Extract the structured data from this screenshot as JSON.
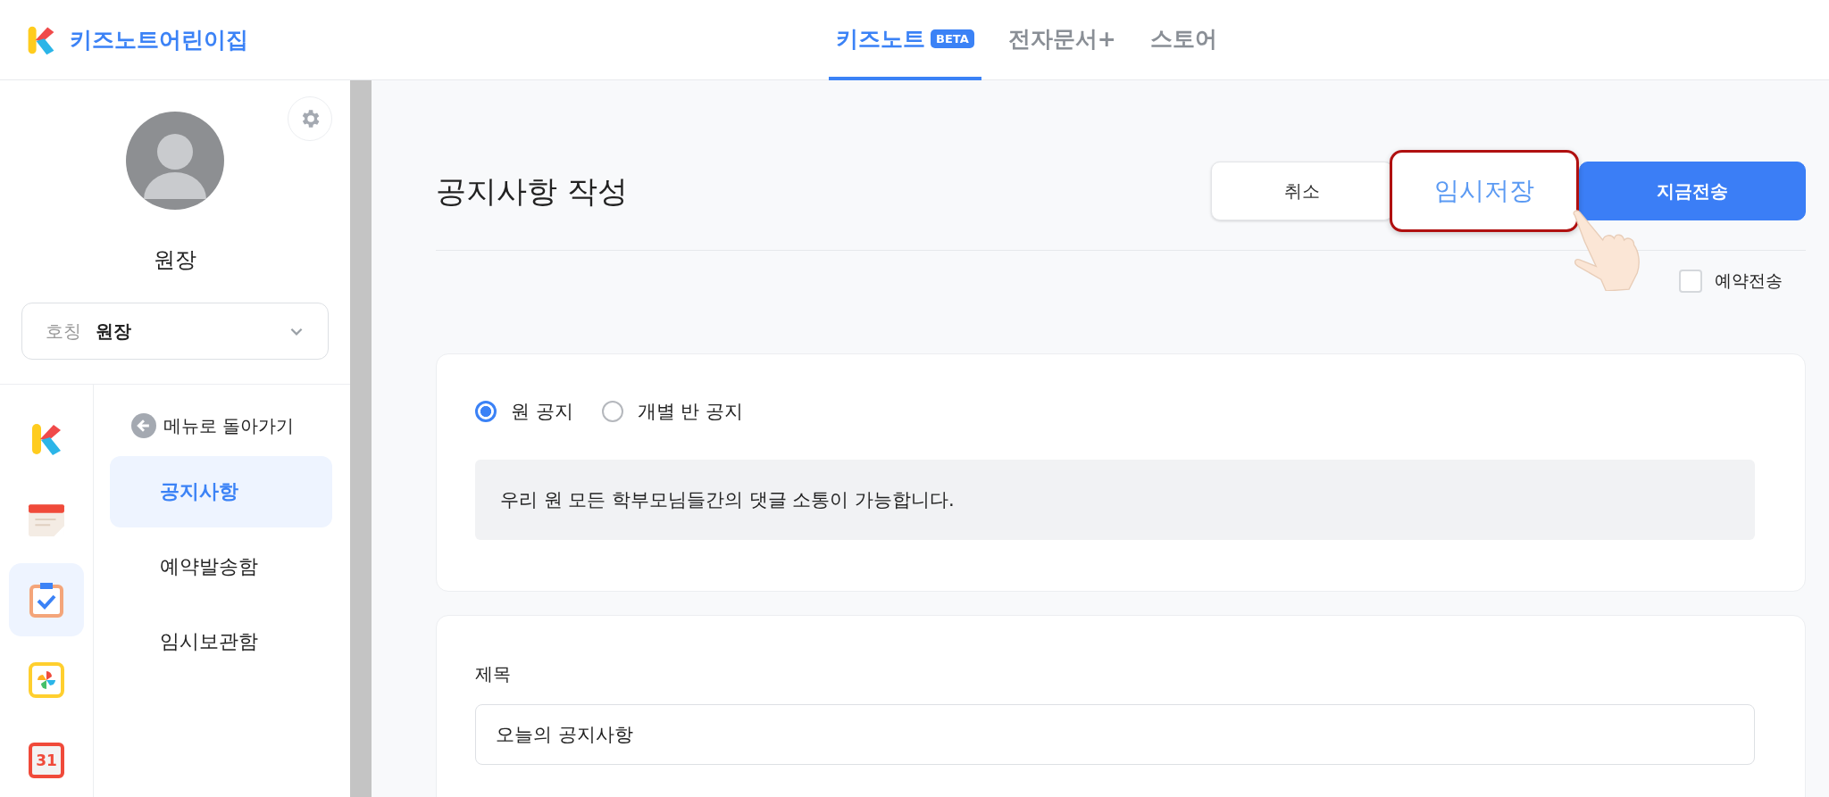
{
  "app": {
    "name": "키즈노트어린이집"
  },
  "nav_tabs": [
    {
      "label": "키즈노트",
      "badge": "BETA",
      "selected": true
    },
    {
      "label": "전자문서+",
      "selected": false
    },
    {
      "label": "스토어",
      "selected": false
    }
  ],
  "profile": {
    "name": "원장",
    "title_select": {
      "label": "호칭",
      "value": "원장"
    }
  },
  "rail_icons": [
    {
      "kind": "logo",
      "selected": false
    },
    {
      "kind": "memo",
      "selected": false
    },
    {
      "kind": "checklist",
      "selected": true
    },
    {
      "kind": "pinwheel",
      "selected": false
    },
    {
      "kind": "date",
      "text": "31",
      "selected": false
    }
  ],
  "menu": {
    "back": "메뉴로 돌아가기",
    "items": [
      {
        "label": "공지사항",
        "selected": true
      },
      {
        "label": "예약발송함",
        "selected": false
      },
      {
        "label": "임시보관함",
        "selected": false
      }
    ]
  },
  "page": {
    "title": "공지사항 작성",
    "buttons": [
      {
        "label": "취소",
        "kind": "secondary"
      },
      {
        "label": "임시저장",
        "kind": "highlighted"
      },
      {
        "label": "지금전송",
        "kind": "primary"
      }
    ],
    "schedule": {
      "label": "예약전송",
      "checked": false
    }
  },
  "scope": {
    "options": [
      {
        "label": "원 공지",
        "selected": true
      },
      {
        "label": "개별 반 공지",
        "selected": false
      }
    ],
    "info": "우리 원 모든 학부모님들간의 댓글 소통이 가능합니다."
  },
  "title_field": {
    "label": "제목",
    "value": "오늘의 공지사항"
  }
}
